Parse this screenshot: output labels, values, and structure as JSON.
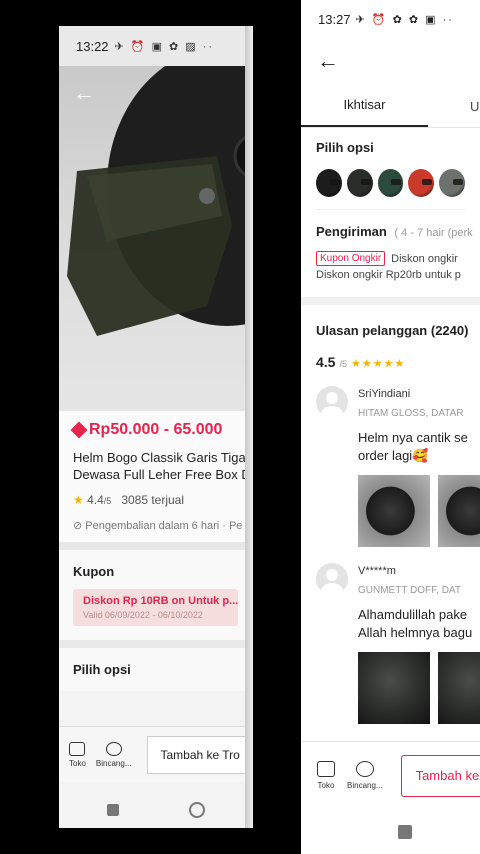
{
  "left": {
    "status_time": "13:22",
    "status_icons": "✈ ⏰ ▣ ✿ ▨ ··",
    "price": "Rp50.000 - 65.000",
    "title_line1": "Helm Bogo Classik Garis Tiga",
    "title_line2": "Dewasa Full Leher Free Box D",
    "rating": "4.4",
    "rating_max": "/5",
    "sold": "3085 terjual",
    "return_policy": "Pengembalian dalam 6 hari · Pe",
    "kupon_title": "Kupon",
    "coupon_line1": "Diskon Rp 10RB on Untuk p...",
    "coupon_line2": "Valid 06/09/2022 - 06/10/2022",
    "pilih_opsi": "Pilih opsi",
    "toko": "Toko",
    "bincang": "Bincang...",
    "add_to_cart": "Tambah ke Tro"
  },
  "right": {
    "status_time": "13:27",
    "status_icons": "✈ ⏰ ✿ ✿ ▣ ··",
    "tab_overview": "Ikhtisar",
    "tab_other": "U",
    "pilih_opsi": "Pilih opsi",
    "swatch_colors": [
      "#1c1c1c",
      "#2a2d2a",
      "#2d4a3f",
      "#c93a2a",
      "#6c716c"
    ],
    "pengiriman": "Pengiriman",
    "pengiriman_sub": "( 4 - 7 hair (perk",
    "kupon_tag": "Kupon Ongkir",
    "kupon_text": "Diskon ongkir",
    "kupon_text2": "Diskon ongkir Rp20rb untuk p",
    "ulasan": "Ulasan pelanggan (2240)",
    "score": "4.5",
    "score_max": "/5",
    "stars": "★★★★★",
    "reviews": [
      {
        "name": "SriYindiani",
        "variant": "HITAM GLOSS, DATAR",
        "text1": "Helm nya cantik se",
        "text2": "order lagi🥰"
      },
      {
        "name": "V*****m",
        "variant": "GUNMETT DOFF, DAT",
        "text1": "Alhamdulillah pake",
        "text2": "Allah helmnya bagu"
      }
    ],
    "toko": "Toko",
    "bincang": "Bincang...",
    "add_to_cart": "Tambah ke"
  }
}
